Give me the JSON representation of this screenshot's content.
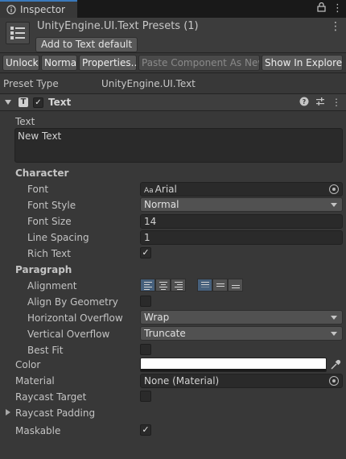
{
  "window": {
    "tab_title": "Inspector",
    "lock_icon": "lock-icon",
    "menu_icon": "kebab-menu-icon"
  },
  "header": {
    "title": "UnityEngine.UI.Text Presets (1)",
    "add_default_label": "Add to Text default"
  },
  "toolbar": {
    "unlock": "Unlock",
    "normal": "Normal",
    "properties": "Properties...",
    "paste": "Paste Component As New",
    "show_in_explorer": "Show In Explorer"
  },
  "preset_type": {
    "label": "Preset Type",
    "value": "UnityEngine.UI.Text"
  },
  "component": {
    "title": "Text",
    "enabled": true
  },
  "text": {
    "label": "Text",
    "value": "New Text"
  },
  "character": {
    "section": "Character",
    "font_label": "Font",
    "font_value": "Arial",
    "font_prefix": "Aa",
    "font_style_label": "Font Style",
    "font_style_value": "Normal",
    "font_size_label": "Font Size",
    "font_size_value": "14",
    "line_spacing_label": "Line Spacing",
    "line_spacing_value": "1",
    "rich_text_label": "Rich Text",
    "rich_text_checked": true
  },
  "paragraph": {
    "section": "Paragraph",
    "alignment_label": "Alignment",
    "horizontal_alignment": "left",
    "vertical_alignment": "top",
    "align_by_geometry_label": "Align By Geometry",
    "align_by_geometry_checked": false,
    "horizontal_overflow_label": "Horizontal Overflow",
    "horizontal_overflow_value": "Wrap",
    "vertical_overflow_label": "Vertical Overflow",
    "vertical_overflow_value": "Truncate",
    "best_fit_label": "Best Fit",
    "best_fit_checked": false
  },
  "color": {
    "label": "Color",
    "value": "#ffffff"
  },
  "material": {
    "label": "Material",
    "value": "None (Material)"
  },
  "raycast_target": {
    "label": "Raycast Target",
    "checked": false
  },
  "raycast_padding": {
    "label": "Raycast Padding"
  },
  "maskable": {
    "label": "Maskable",
    "checked": true
  },
  "colors": {
    "accent": "#3a79bb",
    "panel": "#383838",
    "field": "#2a2a2a"
  }
}
